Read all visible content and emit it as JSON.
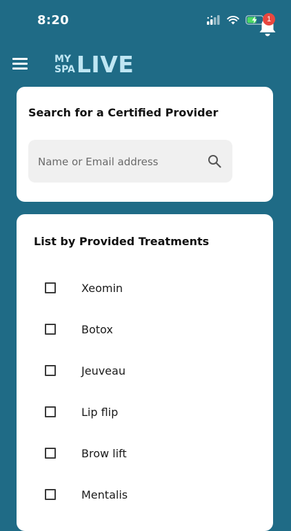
{
  "status_bar": {
    "time": "8:20"
  },
  "header": {
    "logo_small_line1": "MY",
    "logo_small_line2": "SPA",
    "logo_big": "LIVE",
    "notification_count": "1"
  },
  "search_card": {
    "title": "Search for a Certified Provider",
    "placeholder": "Name or Email address",
    "value": ""
  },
  "treatments_card": {
    "title": "List by Provided Treatments",
    "items": [
      {
        "label": "Xeomin",
        "checked": false
      },
      {
        "label": "Botox",
        "checked": false
      },
      {
        "label": "Jeuveau",
        "checked": false
      },
      {
        "label": "Lip flip",
        "checked": false
      },
      {
        "label": "Brow lift",
        "checked": false
      },
      {
        "label": "Mentalis",
        "checked": false
      }
    ]
  },
  "colors": {
    "background": "#1f6b86",
    "logo": "#bfe6f3",
    "badge": "#e8473f",
    "battery_fill": "#4cd964"
  },
  "icons": [
    "signal-icon",
    "wifi-icon",
    "battery-icon",
    "menu-icon",
    "bell-icon",
    "search-icon",
    "checkbox-icon"
  ]
}
